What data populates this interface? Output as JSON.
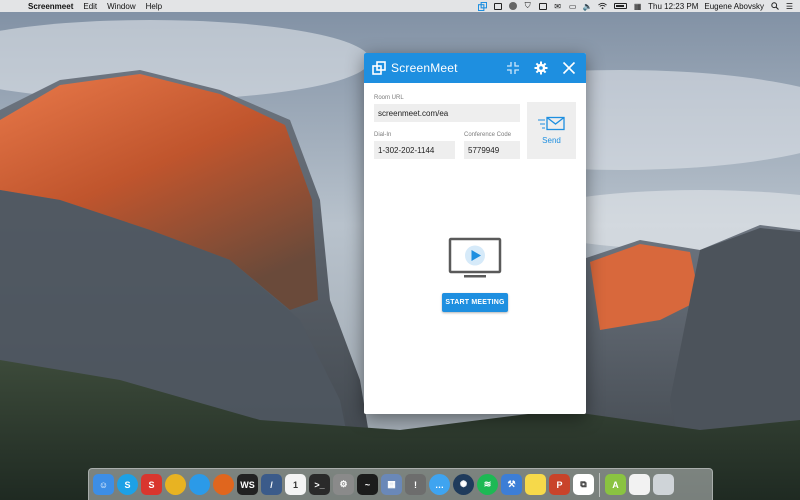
{
  "menubar": {
    "app_name": "Screenmeet",
    "menus": [
      "Edit",
      "Window",
      "Help"
    ],
    "clock": "Thu 12:23 PM",
    "user": "Eugene Abovsky"
  },
  "window": {
    "title": "ScreenMeet",
    "room_url_label": "Room URL",
    "room_url_value": "screenmeet.com/ea",
    "dialin_label": "Dial-In",
    "dialin_value": "1-302-202-1144",
    "conference_label": "Conference Code",
    "conference_value": "5779949",
    "send_label": "Send",
    "start_button": "START MEETING"
  },
  "colors": {
    "accent": "#1e8fe0",
    "field_bg": "#eeeeee",
    "label_gray": "#7c7c7c",
    "icon_gray": "#5a5a5a"
  },
  "dock": {
    "items": [
      {
        "name": "finder",
        "glyph": "☺",
        "color": "#3d8ee6"
      },
      {
        "name": "skype",
        "glyph": "S",
        "color": "#1da1e6"
      },
      {
        "name": "screenmeet-red",
        "glyph": "S",
        "color": "#d9362e"
      },
      {
        "name": "chrome",
        "glyph": "",
        "color": "#e8b322"
      },
      {
        "name": "safari",
        "glyph": "",
        "color": "#2b9ae8"
      },
      {
        "name": "firefox",
        "glyph": "",
        "color": "#e0661e"
      },
      {
        "name": "webstorm",
        "glyph": "WS",
        "color": "#222222"
      },
      {
        "name": "xcode-instruments",
        "glyph": "/",
        "color": "#3b5b8a"
      },
      {
        "name": "calendar",
        "glyph": "1",
        "color": "#f4f4f4"
      },
      {
        "name": "terminal",
        "glyph": ">_",
        "color": "#2a2a2a"
      },
      {
        "name": "system-preferences",
        "glyph": "⚙",
        "color": "#8a8a8a"
      },
      {
        "name": "activity-monitor",
        "glyph": "~",
        "color": "#1c1c1c"
      },
      {
        "name": "preview",
        "glyph": "▦",
        "color": "#6a88b8"
      },
      {
        "name": "console",
        "glyph": "!",
        "color": "#6d6d6d"
      },
      {
        "name": "messages",
        "glyph": "…",
        "color": "#3fa4f0"
      },
      {
        "name": "network-tool",
        "glyph": "✺",
        "color": "#1f3b5c"
      },
      {
        "name": "spotify",
        "glyph": "≋",
        "color": "#1db954"
      },
      {
        "name": "xcode",
        "glyph": "⚒",
        "color": "#3d7ed6"
      },
      {
        "name": "stickies",
        "glyph": "",
        "color": "#f6d94a"
      },
      {
        "name": "powerpoint",
        "glyph": "P",
        "color": "#c9432a"
      },
      {
        "name": "screenmeet-blue",
        "glyph": "⧉",
        "color": "#ffffff"
      },
      {
        "name": "android-studio",
        "glyph": "A",
        "color": "#8ac341"
      },
      {
        "name": "document",
        "glyph": "",
        "color": "#f2f2f2"
      },
      {
        "name": "trash",
        "glyph": "",
        "color": "#cfd4d8"
      }
    ]
  }
}
